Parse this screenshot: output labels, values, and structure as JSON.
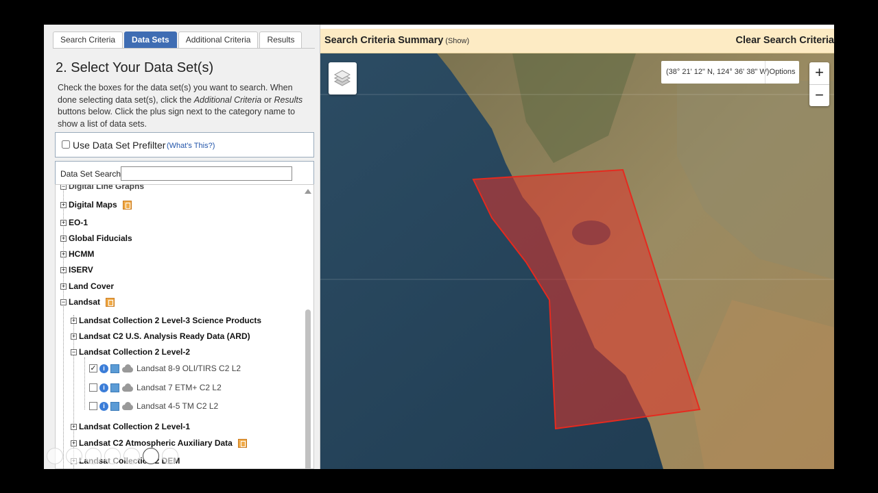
{
  "tabs": [
    {
      "label": "Search Criteria",
      "active": false
    },
    {
      "label": "Data Sets",
      "active": true
    },
    {
      "label": "Additional Criteria",
      "active": false
    },
    {
      "label": "Results",
      "active": false
    }
  ],
  "step_title": "2. Select Your Data Set(s)",
  "instructions": {
    "part1": "Check the boxes for the data set(s) you want to search. When done selecting data set(s), click the ",
    "em1": "Additional Criteria",
    "part2": " or ",
    "em2": "Results",
    "part3": " buttons below. Click the plus sign next to the category name to show a list of data sets."
  },
  "prefilter": {
    "label": "Use Data Set Prefilter",
    "help": "(What's This?)",
    "checked": false
  },
  "dataset_search": {
    "label": "Data Set Search:",
    "value": ""
  },
  "tree": {
    "partial_top": "Digital Line Graphs",
    "categories": [
      {
        "label": "Digital Maps",
        "expander": "+",
        "bookmark": true
      },
      {
        "label": "EO-1",
        "expander": "+",
        "bookmark": false
      },
      {
        "label": "Global Fiducials",
        "expander": "+",
        "bookmark": false
      },
      {
        "label": "HCMM",
        "expander": "+",
        "bookmark": false
      },
      {
        "label": "ISERV",
        "expander": "+",
        "bookmark": false
      },
      {
        "label": "Land Cover",
        "expander": "+",
        "bookmark": false
      },
      {
        "label": "Landsat",
        "expander": "−",
        "bookmark": true
      }
    ],
    "landsat_children": [
      {
        "label": "Landsat Collection 2 Level-3 Science Products",
        "expander": "+",
        "bookmark": false
      },
      {
        "label": "Landsat C2 U.S. Analysis Ready Data (ARD)",
        "expander": "+",
        "bookmark": false
      },
      {
        "label": "Landsat Collection 2 Level-2",
        "expander": "−",
        "bookmark": false
      }
    ],
    "level2_datasets": [
      {
        "label": "Landsat 8-9 OLI/TIRS C2 L2",
        "checked": true
      },
      {
        "label": "Landsat 7 ETM+ C2 L2",
        "checked": false
      },
      {
        "label": "Landsat 4-5 TM C2 L2",
        "checked": false
      }
    ],
    "more_children": [
      {
        "label": "Landsat Collection 2 Level-1",
        "expander": "+",
        "bookmark": false
      },
      {
        "label": "Landsat C2 Atmospheric Auxiliary Data",
        "expander": "+",
        "bookmark": true
      },
      {
        "label": "Landsat Collection 2 DEM",
        "expander": "+",
        "bookmark": false
      }
    ]
  },
  "summary": {
    "title": "Search Criteria Summary",
    "show": "(Show)",
    "clear": "Clear Search Criteria"
  },
  "map": {
    "coordinates": "(38° 21' 12\" N, 124° 36' 38\" W)",
    "options": "Options",
    "zoom_in": "+",
    "zoom_out": "−",
    "layers_icon": "layers-icon"
  },
  "colors": {
    "active_tab": "#3f6db3",
    "summary_bg": "#fdebc4",
    "aoi_fill": "#e0342c",
    "link": "#2255aa"
  }
}
